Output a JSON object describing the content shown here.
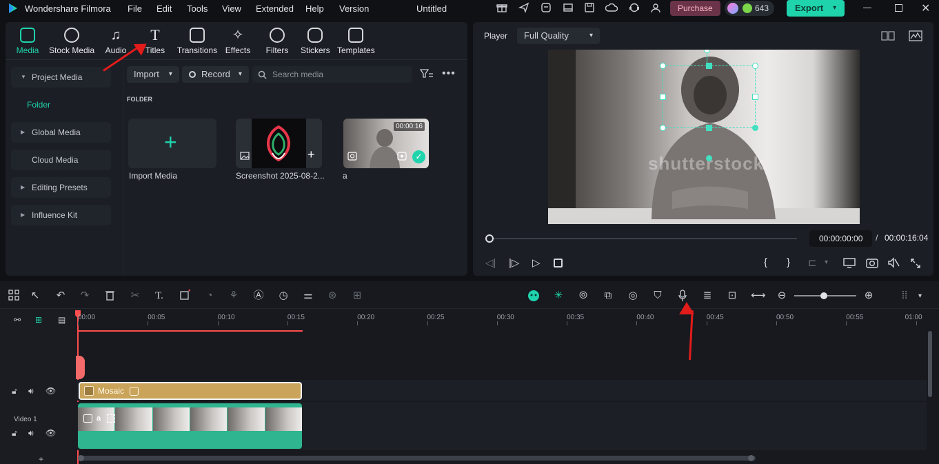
{
  "app": {
    "title": "Wondershare Filmora",
    "menu": [
      "File",
      "Edit",
      "Tools",
      "View",
      "Extended",
      "Help",
      "Version"
    ],
    "project_name": "Untitled",
    "purchase_label": "Purchase",
    "credits": "643",
    "export_label": "Export"
  },
  "media_tabs": [
    {
      "label": "Media",
      "active": true,
      "icon": "media-icon"
    },
    {
      "label": "Stock Media",
      "icon": "stock-media-icon"
    },
    {
      "label": "Audio",
      "icon": "audio-icon"
    },
    {
      "label": "Titles",
      "icon": "titles-icon"
    },
    {
      "label": "Transitions",
      "icon": "transitions-icon"
    },
    {
      "label": "Effects",
      "icon": "effects-icon"
    },
    {
      "label": "Filters",
      "icon": "filters-icon"
    },
    {
      "label": "Stickers",
      "icon": "stickers-icon"
    },
    {
      "label": "Templates",
      "icon": "templates-icon"
    }
  ],
  "sidebar": {
    "items": [
      {
        "label": "Project Media",
        "expanded": true
      },
      {
        "label": "Folder"
      },
      {
        "label": "Global Media"
      },
      {
        "label": "Cloud Media"
      },
      {
        "label": "Editing Presets"
      },
      {
        "label": "Influence Kit"
      }
    ]
  },
  "media_toolbar": {
    "import_label": "Import",
    "record_label": "Record",
    "search_placeholder": "Search media"
  },
  "media_grid": {
    "folder_heading": "FOLDER",
    "items": [
      {
        "label": "Import Media"
      },
      {
        "label": "Screenshot 2025-08-2..."
      },
      {
        "label": "a",
        "duration": "00:00:16"
      }
    ]
  },
  "player": {
    "label": "Player",
    "quality": "Full Quality",
    "current_time": "00:00:00:00",
    "separator": "/",
    "total_time": "00:00:16:04",
    "watermark": "shutterstock"
  },
  "timeline": {
    "ruler": [
      "00:00",
      "00:05",
      "00:10",
      "00:15",
      "00:20",
      "00:25",
      "00:30",
      "00:35",
      "00:40",
      "00:45",
      "00:50",
      "00:55",
      "01:00"
    ],
    "effect_clip_label": "Mosaic",
    "video_track_label": "Video 1",
    "video_clip_label": "a"
  },
  "colors": {
    "accent": "#1fd4ad",
    "playhead": "#ff4d4d",
    "mosaic_clip": "#c9a45a",
    "video_clip": "#2fb58f",
    "annotation_arrow": "#e21b1b"
  }
}
